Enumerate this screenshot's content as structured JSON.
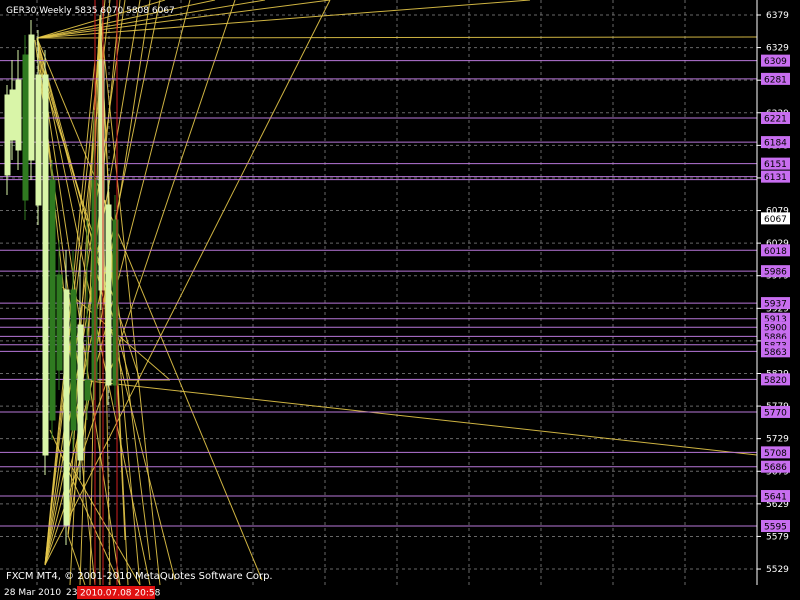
{
  "chart_data": {
    "type": "candlestick",
    "title": "GER30,Weekly  5835 6070 5808 6067",
    "symbol": "GER30",
    "timeframe": "Weekly",
    "ohlc_current": {
      "open": 5835,
      "high": 6070,
      "low": 5808,
      "close": 6067
    },
    "current_price": 6067,
    "ylim": [
      5515,
      6390
    ],
    "y_ticks": [
      6379,
      6329,
      6279,
      6229,
      6179,
      6129,
      6079,
      6029,
      5979,
      5929,
      5879,
      5829,
      5779,
      5729,
      5679,
      5629,
      5579,
      5529
    ],
    "grid": true,
    "x_labels": [
      "28 Mar 2010",
      "23"
    ],
    "time_badge": "2010.07.08 20:58",
    "copyright": "FXCM MT4, © 2001-2010 MetaQuotes Software Corp.",
    "horizontal_levels": [
      6309,
      6281,
      6221,
      6184,
      6151,
      6131,
      6018,
      5986,
      5937,
      5913,
      5900,
      5886,
      5873,
      5863,
      5820,
      5770,
      5708,
      5686,
      5641,
      5595
    ],
    "colors": {
      "background": "#000000",
      "grid": "#8a8a8a",
      "level_line": "#b877d9",
      "level_badge": "#c86ef0",
      "trend_line": "#e6c84a",
      "bull_candle": "#d9f5a8",
      "bear_candle": "#2f7a20",
      "vertical_marker": "#d22020",
      "price_badge_bg": "#ffffff",
      "time_badge_bg": "#e01010"
    }
  }
}
